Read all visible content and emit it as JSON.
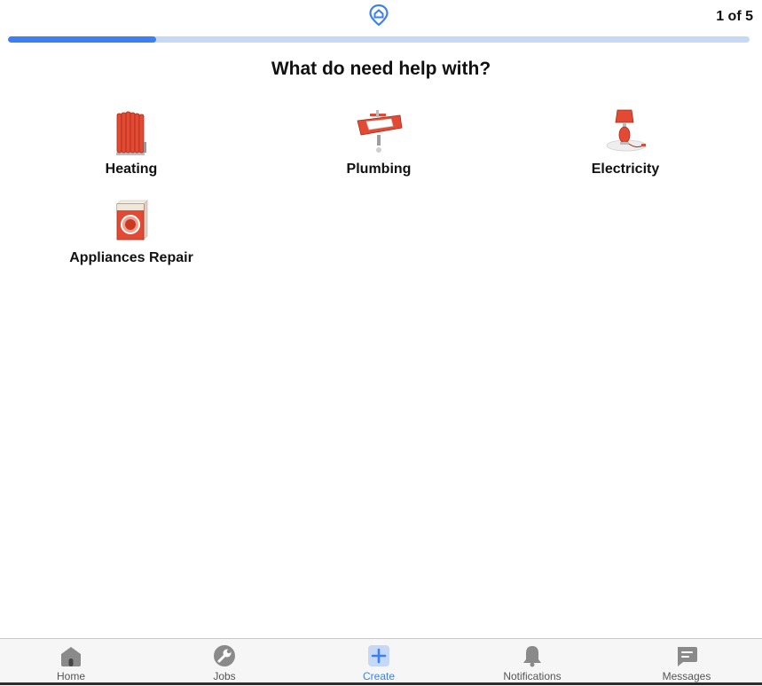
{
  "header": {
    "logo_icon": "home-location-pin-icon",
    "step_text": "1 of 5",
    "progress_fraction": 0.2
  },
  "main": {
    "question": "What do need help with?",
    "categories": [
      {
        "label": "Heating",
        "icon": "radiator-icon"
      },
      {
        "label": "Plumbing",
        "icon": "sink-icon"
      },
      {
        "label": "Electricity",
        "icon": "lamp-icon"
      },
      {
        "label": "Appliances Repair",
        "icon": "washing-machine-icon"
      }
    ]
  },
  "tabbar": {
    "tabs": [
      {
        "label": "Home",
        "icon": "home-icon",
        "active": false
      },
      {
        "label": "Jobs",
        "icon": "wrench-icon",
        "active": false
      },
      {
        "label": "Create",
        "icon": "plus-icon",
        "active": true
      },
      {
        "label": "Notifications",
        "icon": "bell-icon",
        "active": false
      },
      {
        "label": "Messages",
        "icon": "message-icon",
        "active": false
      }
    ]
  },
  "colors": {
    "accent": "#3b7ff0",
    "progress_track": "#c5d9f6",
    "icon_red": "#e34a33",
    "tab_icon_gray": "#8a8a8a"
  }
}
